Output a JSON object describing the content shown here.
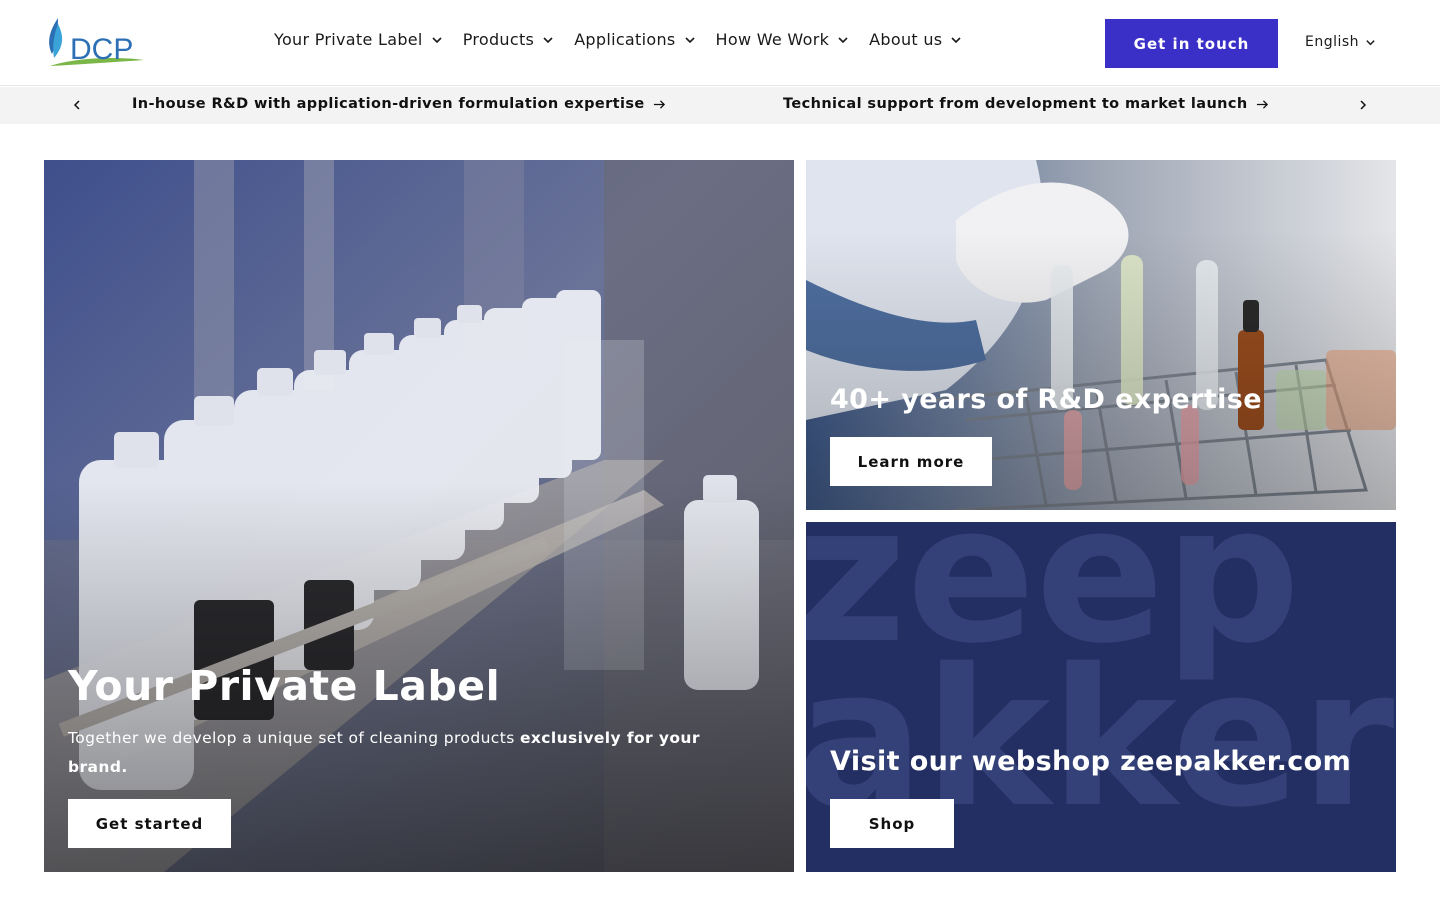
{
  "header": {
    "logo_text": "DCP",
    "nav": [
      {
        "label": "Your Private Label",
        "icon": "chevron-down-icon"
      },
      {
        "label": "Products",
        "icon": "chevron-down-icon"
      },
      {
        "label": "Applications",
        "icon": "chevron-down-icon"
      },
      {
        "label": "How We Work",
        "icon": "chevron-down-icon"
      },
      {
        "label": "About us",
        "icon": "chevron-down-icon"
      }
    ],
    "cta_label": "Get in touch",
    "language": "English"
  },
  "announcement": {
    "items": [
      "In-house R&D with application-driven formulation expertise",
      "Technical support from development to market launch"
    ]
  },
  "hero": {
    "title": "Your Private Label",
    "desc_plain": "Together we develop a unique set of cleaning products ",
    "desc_bold": "exclusively for your brand.",
    "button": "Get started"
  },
  "rd_card": {
    "title": "40+ years of R&D expertise",
    "button": "Learn more"
  },
  "shop_card": {
    "bg_word_1": "zeep",
    "bg_word_2": "akker",
    "title": "Visit our webshop zeepakker.com",
    "button": "Shop"
  },
  "colors": {
    "accent": "#3a2fc6",
    "shop_bg": "#232f63",
    "announce_bg": "#f3f3f3"
  }
}
